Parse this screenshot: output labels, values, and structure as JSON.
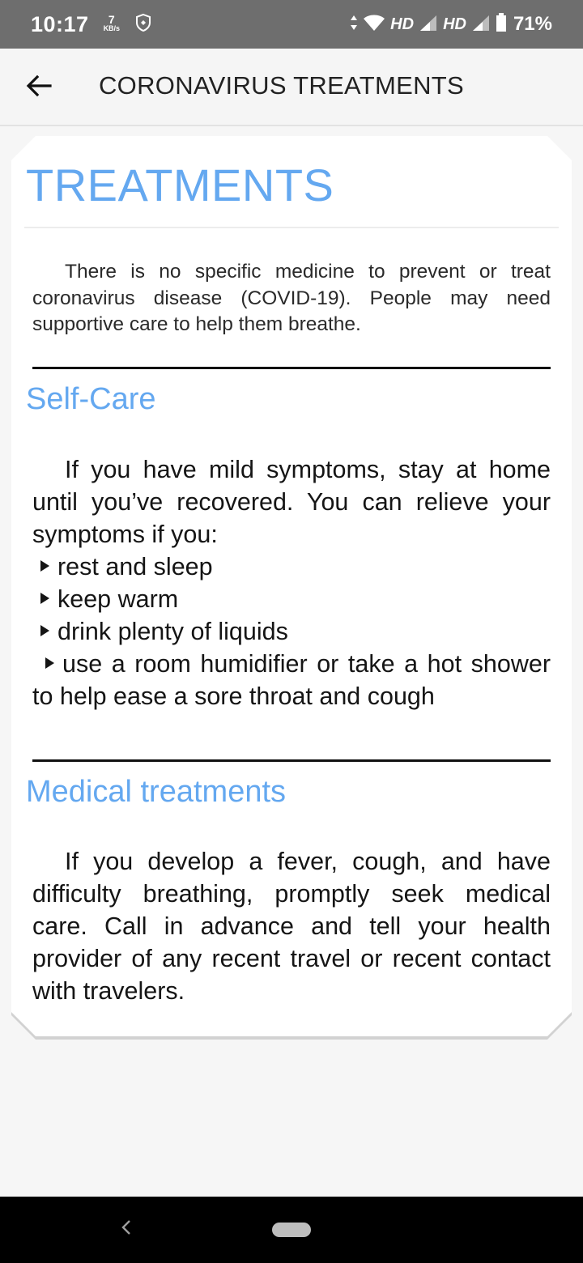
{
  "status_bar": {
    "time": "10:17",
    "net_speed_value": "7",
    "net_speed_unit": "KB/s",
    "hd_1": "HD",
    "hd_2": "HD",
    "battery": "71%"
  },
  "app_bar": {
    "title": "CORONAVIRUS TREATMENTS",
    "back_icon": "arrow-left-icon"
  },
  "content": {
    "heading": "TREATMENTS",
    "intro": "There is no specific medicine to prevent or treat coronavirus disease (COVID-19). People may need supportive care to help them breathe.",
    "self_care": {
      "heading": "Self-Care",
      "text": "If you have mild symptoms, stay at home until you’ve recovered. You can relieve your symptoms if you:",
      "bullets": [
        "rest and sleep",
        "keep warm",
        "drink plenty of liquids",
        "use a room humidifier or take a hot shower to help ease a sore throat and cough"
      ]
    },
    "medical": {
      "heading": "Medical treatments",
      "text": "If you develop a fever, cough, and have difficulty breathing, promptly seek medical care. Call in advance and tell your health provider of any recent travel or recent contact with travelers."
    }
  },
  "colors": {
    "heading_blue": "#64a8f0",
    "status_bar": "#6e6e6e",
    "nav_bar": "#000000"
  }
}
